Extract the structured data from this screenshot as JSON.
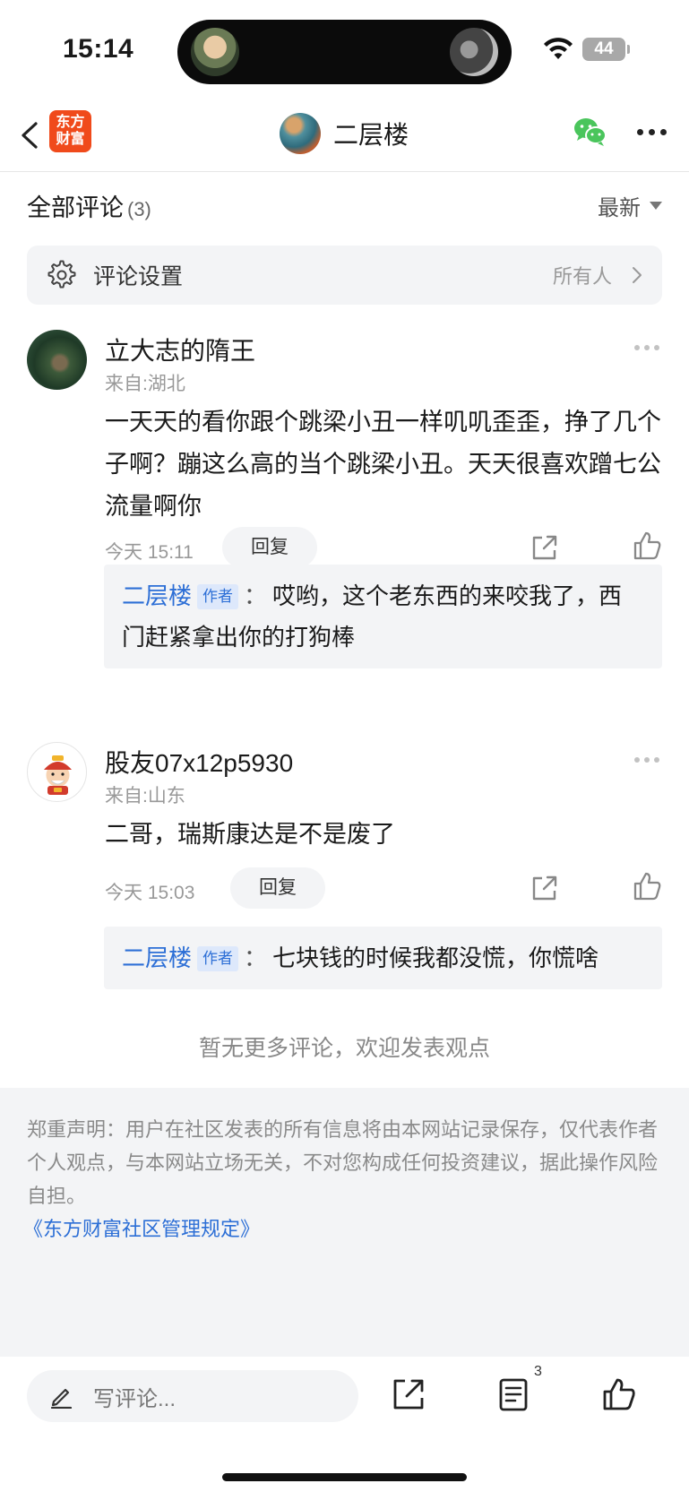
{
  "status_bar": {
    "time": "15:14",
    "battery": "44"
  },
  "header": {
    "brand_line1": "东方",
    "brand_line2": "财富",
    "title": "二层楼"
  },
  "comments_section": {
    "title": "全部评论",
    "count": "(3)",
    "sort_label": "最新"
  },
  "settings": {
    "label": "评论设置",
    "value": "所有人"
  },
  "comments": [
    {
      "author": "立大志的隋王",
      "location": "来自:湖北",
      "text": "一天天的看你跟个跳梁小丑一样叽叽歪歪，挣了几个子啊？蹦这么高的当个跳梁小丑。天天很喜欢蹭七公流量啊你",
      "time": "今天 15:11",
      "reply_label": "回复",
      "reply": {
        "author": "二层楼",
        "badge": "作者",
        "colon": "：",
        "text": "哎哟，这个老东西的来咬我了，西门赶紧拿出你的打狗棒"
      }
    },
    {
      "author": "股友07x12p5930",
      "location": "来自:山东",
      "text": "二哥，瑞斯康达是不是废了",
      "time": "今天 15:03",
      "reply_label": "回复",
      "reply": {
        "author": "二层楼",
        "badge": "作者",
        "colon": "：",
        "text": "七块钱的时候我都没慌，你慌啥"
      }
    }
  ],
  "no_more_text": "暂无更多评论，欢迎发表观点",
  "disclaimer": {
    "text": "郑重声明：用户在社区发表的所有信息将由本网站记录保存，仅代表作者个人观点，与本网站立场无关，不对您构成任何投资建议，据此操作风险自担。",
    "rules_link": "《东方财富社区管理规定》"
  },
  "bottom_bar": {
    "input_placeholder": "写评论...",
    "comment_count": "3"
  },
  "colors": {
    "link_blue": "#2d6fd6",
    "brand_orange": "#f04a1b",
    "wechat_green": "#4ac55c"
  }
}
